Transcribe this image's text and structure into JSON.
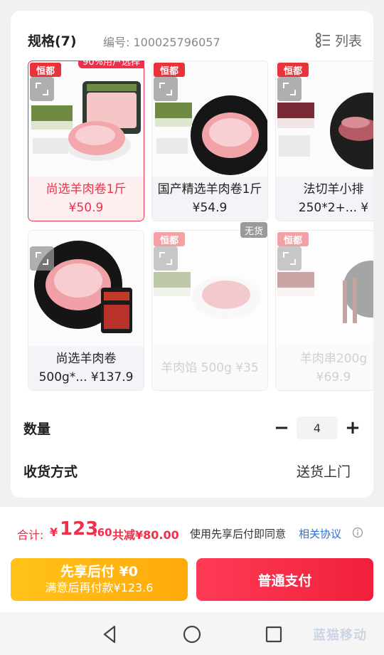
{
  "spec": {
    "title": "规格(7)",
    "code": "编号: 100025796057",
    "list_label": "列表",
    "list_icon": "list-view-icon"
  },
  "products": [
    {
      "brand": "恒都",
      "badge": "90%用户选择",
      "name": "尚选羊肉卷1斤\n¥50.9",
      "selected": true,
      "soldout": false,
      "image": "lamb-roll-package-image"
    },
    {
      "brand": "恒都",
      "badge": "",
      "name": "国产精选羊肉卷1斤 ¥54.9",
      "selected": false,
      "soldout": false,
      "image": "lamb-roll-plate-image"
    },
    {
      "brand": "恒都",
      "badge": "",
      "name": "法切羊小排\n250*2+... ¥",
      "selected": false,
      "soldout": false,
      "image": "lamb-ribs-image"
    },
    {
      "brand": "",
      "badge": "",
      "name": "尚选羊肉卷\n500g*... ¥137.9",
      "selected": false,
      "soldout": false,
      "image": "lamb-roll-hotpot-image"
    },
    {
      "brand": "恒都",
      "badge": "无货",
      "name": "羊肉馅 500g ¥35",
      "selected": false,
      "soldout": true,
      "image": "minced-lamb-image"
    },
    {
      "brand": "恒都",
      "badge": "",
      "name": "羊肉串200g\n¥69.9",
      "selected": false,
      "soldout": true,
      "image": "lamb-skewers-image"
    }
  ],
  "quantity": {
    "label": "数量",
    "value": "4",
    "minus": "−",
    "plus": "+"
  },
  "delivery": {
    "label": "收货方式",
    "value": "送货上门"
  },
  "summary": {
    "total_label": "合计:",
    "currency": "¥",
    "total_int": "123",
    "total_dec": ".60",
    "discount": "共减¥80.00",
    "agree_text": "使用先享后付即同意",
    "agree_link": "相关协议",
    "info_icon": "info-icon"
  },
  "buttons": {
    "later_title": "先享后付 ¥0",
    "later_sub": "满意后再付款¥123.6",
    "normal": "普通支付"
  },
  "watermark": "蓝猫移动",
  "colors": {
    "accent": "#f0304a",
    "link": "#2a6fd6",
    "later": "#ffb411"
  }
}
